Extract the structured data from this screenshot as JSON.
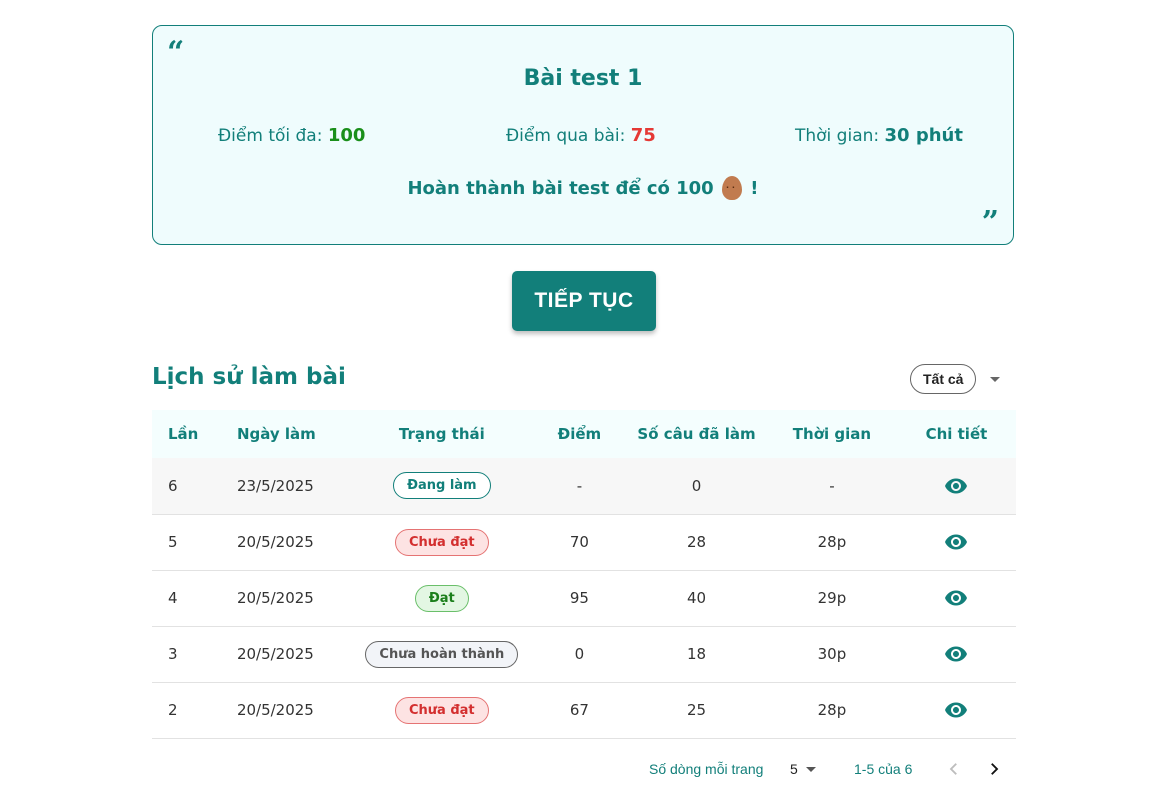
{
  "test_card": {
    "title": "Bài test 1",
    "max_score_label": "Điểm tối đa: ",
    "max_score_value": "100",
    "pass_score_label": "Điểm qua bài: ",
    "pass_score_value": "75",
    "time_label": "Thời gian: ",
    "time_value": "30 phút",
    "reward_text_before": "Hoàn thành bài test để có 100",
    "reward_text_after": "!",
    "open_quote": "“",
    "close_quote": "”"
  },
  "continue_button": {
    "label": "TIẾP TỤC"
  },
  "history": {
    "title": "Lịch sử làm bài",
    "filter": {
      "selected": "Tất cả"
    },
    "columns": [
      "Lần",
      "Ngày làm",
      "Trạng thái",
      "Điểm",
      "Số câu đã làm",
      "Thời gian",
      "Chi tiết"
    ],
    "rows": [
      {
        "attempt": "6",
        "date": "23/5/2025",
        "status": "Đang làm",
        "score": "-",
        "answered": "0",
        "time": "-"
      },
      {
        "attempt": "5",
        "date": "20/5/2025",
        "status": "Chưa đạt",
        "score": "70",
        "answered": "28",
        "time": "28p"
      },
      {
        "attempt": "4",
        "date": "20/5/2025",
        "status": "Đạt",
        "score": "95",
        "answered": "40",
        "time": "29p"
      },
      {
        "attempt": "3",
        "date": "20/5/2025",
        "status": "Chưa hoàn thành",
        "score": "0",
        "answered": "18",
        "time": "30p"
      },
      {
        "attempt": "2",
        "date": "20/5/2025",
        "status": "Chưa đạt",
        "score": "67",
        "answered": "25",
        "time": "28p"
      }
    ],
    "detail_icon": "eye-icon"
  },
  "pagination": {
    "rows_per_page_label": "Số dòng mỗi trang",
    "rows_per_page_value": "5",
    "range_text": "1-5 của 6",
    "prev_icon": "chevron-left-icon",
    "next_icon": "chevron-right-icon"
  },
  "colors": {
    "primary": "#127f7a",
    "card_background": "#effcfd",
    "pass_green": "#1a8f1a",
    "fail_red": "#e53935"
  }
}
